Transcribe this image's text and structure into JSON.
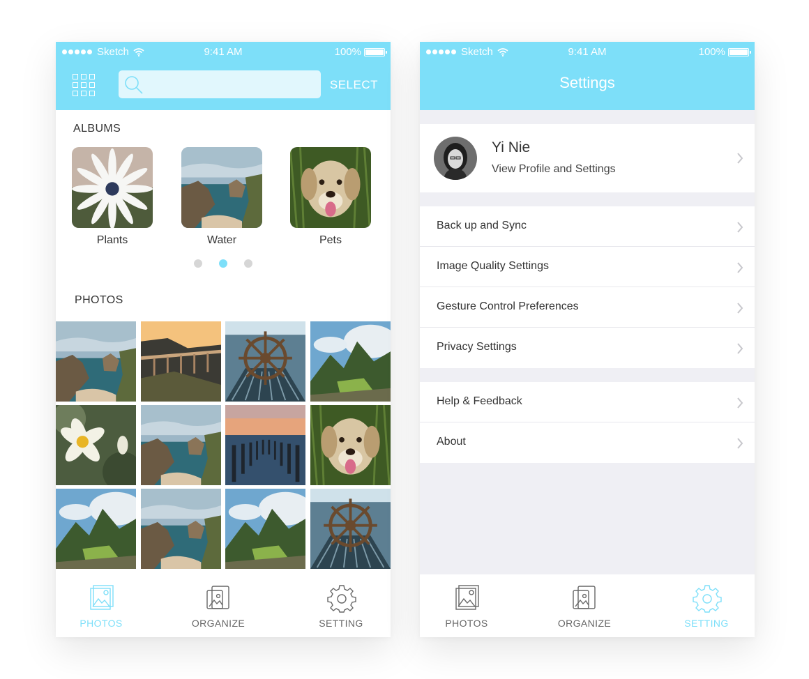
{
  "status_bar": {
    "carrier": "Sketch",
    "time": "9:41 AM",
    "battery": "100%"
  },
  "photos_screen": {
    "search": {
      "value": "",
      "placeholder": ""
    },
    "select_label": "SELECT",
    "albums_heading": "ALBUMS",
    "albums": [
      {
        "name": "Plants",
        "icon": "daisy-photo"
      },
      {
        "name": "Water",
        "icon": "coast-photo"
      },
      {
        "name": "Pets",
        "icon": "dog-photo"
      }
    ],
    "pager": {
      "count": 3,
      "active_index": 1
    },
    "photos_heading": "PHOTOS",
    "photos": [
      "coast",
      "bridge",
      "ship-wheel",
      "mountain",
      "daffodil",
      "coast",
      "pier-posts",
      "dog",
      "mountain",
      "coast",
      "mountain",
      "ship-wheel"
    ]
  },
  "settings_screen": {
    "title": "Settings",
    "profile": {
      "name": "Yi Nie",
      "subtitle": "View Profile and Settings"
    },
    "group1": [
      "Back up and Sync",
      "Image Quality Settings",
      "Gesture Control Preferences",
      "Privacy Settings"
    ],
    "group2": [
      "Help & Feedback",
      "About"
    ]
  },
  "tabbar": {
    "photos": "PHOTOS",
    "organize": "ORGANIZE",
    "setting": "SETTING"
  },
  "colors": {
    "accent": "#7ddff9",
    "header_text": "#ffffff",
    "tab_inactive": "#666666",
    "settings_bg": "#efeff4"
  }
}
